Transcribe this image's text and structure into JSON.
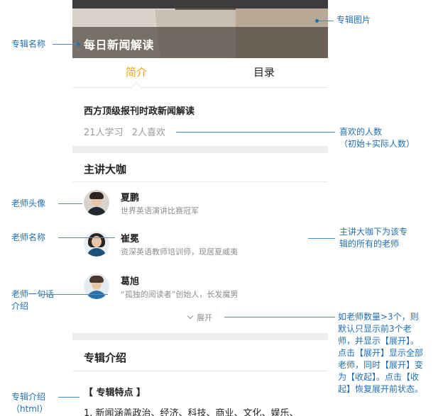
{
  "album": {
    "title": "每日新闻解读",
    "subtitle": "西方顶级报刊时政新闻解读",
    "learners": "21人学习",
    "likes": "2人喜欢"
  },
  "tabs": [
    {
      "label": "简介",
      "active": true
    },
    {
      "label": "目录",
      "active": false
    }
  ],
  "teachers_section": {
    "title": "主讲大咖",
    "expand_label": "展开",
    "teachers": [
      {
        "name": "夏鹏",
        "desc": "世界英语演讲比赛冠军"
      },
      {
        "name": "崔冕",
        "desc": "资深英语教师培训师，现居夏威夷"
      },
      {
        "name": "葛旭",
        "desc": "“孤独的阅读者”创始人，长发魔男"
      }
    ]
  },
  "intro_section": {
    "title": "专辑介绍",
    "feature_heading": "【 专辑特点 】",
    "first_line": "1. 新闻涵盖政治、经济、科技、商业、文化、娱乐、"
  },
  "annotations": {
    "album_image": "专辑图片",
    "album_name": "专辑名称",
    "likes_count_1": "喜欢的人数",
    "likes_count_2": "（初始+实际人数）",
    "teacher_avatar": "老师头像",
    "teacher_name": "老师名称",
    "teachers_all_1": "主讲大咖下为该专",
    "teachers_all_2": "辑的所有的老师",
    "teacher_desc_1": "老师一句话",
    "teacher_desc_2": "介绍",
    "expand_rule": [
      "如老师数量>3个，则",
      "默认只显示前3个老",
      "师，并显示【展开】。",
      "点击【展开】显示全部",
      "老师，同时【展开】变",
      "为【收起】。点击【收",
      "起】恢复展开前状态。"
    ],
    "album_intro_1": "专辑介绍",
    "album_intro_2": "（html）"
  },
  "colors": {
    "accent": "#f0a30a",
    "annotation": "#1f6fb5",
    "divider": "#eeeeee"
  }
}
